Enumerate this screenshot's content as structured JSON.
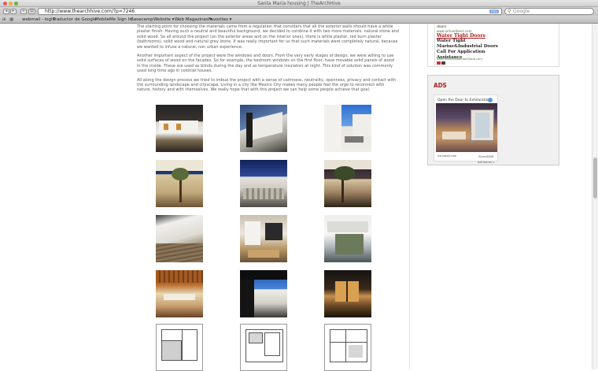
{
  "window": {
    "title": "Santa Maria housing | TheArchHive"
  },
  "toolbar": {
    "url": "http://www.thearchhive.com/?p=7246",
    "rss_label": "RSS",
    "search_placeholder": "Google"
  },
  "bookmarks": [
    "webmail - login",
    "Traductor de Google",
    "MobileMe Sign In",
    "Basecamp",
    "Website ▾",
    "Web Magazines ▾",
    "Favorites ▾"
  ],
  "article": {
    "paragraphs": [
      "The starting point for choosing the materials came from a regulation that considers that all the exterior walls should have a white plaster finish. Having such a neutral and beautiful background, we decided to combine it with two more materials: natural stone and solid wood. So all around the project (on the exterior areas and on the interior ones), there is white plaster, red burn plaster (bathrooms), solid wood and natural grey stone. It was really important for us that such materials were completely natural, because we wanted to infuse a natural, non urban experience.",
      "Another important aspect of the project were the windows and doors. From the very early stages of design, we were willing to use solid surfaces of wood on the facades. So for example, the bedroom windows on the first floor, have movable solid panels of wood in the inside. These are used as blinds during the day and as temperature insulators at night. This kind of solution was commonly used long time ago in colonial houses.",
      "All along the design process we tried to imbue the project with a sense of calmness, neutrality, openness, privacy and contact with the surrounding landscape and cityscape. Living in a city like Mexico City makes many people feel the urge to reconnect with nature, history and with themselves. We really hope that with this project we can help some people achieve that goal."
    ]
  },
  "gallery": {
    "thumbnails": [
      {
        "name": "exterior-dusk-photo"
      },
      {
        "name": "facade-perspective-photo"
      },
      {
        "name": "courtyard-blue-photo"
      },
      {
        "name": "tree-patio-photo"
      },
      {
        "name": "stone-wall-photo"
      },
      {
        "name": "twilight-tree-photo"
      },
      {
        "name": "deck-shadow-photo"
      },
      {
        "name": "interior-stair-photo"
      },
      {
        "name": "white-frame-photo"
      },
      {
        "name": "wood-ceiling-photo"
      },
      {
        "name": "overhang-sky-photo"
      },
      {
        "name": "night-window-photo"
      },
      {
        "name": "floor-plan-1"
      },
      {
        "name": "floor-plan-2"
      },
      {
        "name": "floor-plan-3"
      }
    ]
  },
  "sidebar": {
    "ad_top": {
      "domain_line_1": "doors",
      "domain_line_2": "www.virtualdoors.com",
      "headline": "Water Tight Doors",
      "body": "Water Tight Marine&Industrial Doors Call For Application Assistance",
      "url": "www.ShearEquipmentStore.com"
    },
    "ads_heading": "ADS",
    "ad_bottom": {
      "headline": "Open the Door to Exhilaratio",
      "footer_left": "nanawall.com",
      "footer_right": "NanaWall"
    },
    "adchoices_label": "AdChoices ▷"
  },
  "colors": {
    "accent_red": "#b01818",
    "link_blue": "#3355aa"
  }
}
